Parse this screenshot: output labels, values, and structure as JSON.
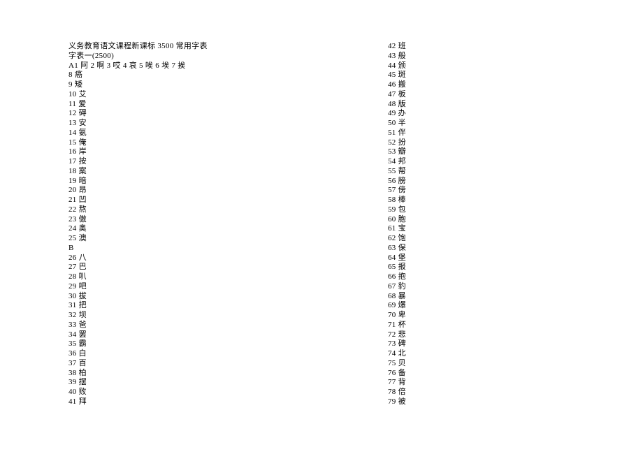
{
  "title": "义务教育语文课程新课标 3500 常用字表",
  "subtitle": "字表一(2500)",
  "line_a": "A1 阿 2 啊 3 哎 4 哀 5 唉 6 埃 7 挨",
  "section_b": "B",
  "left_entries": [
    "8 癌",
    "9 矮",
    "10 艾",
    "11 爱",
    "12 碍",
    "13 安",
    "14 氨",
    "15 俺",
    "16 岸",
    "17 按",
    "18 案",
    "19 暗",
    "20 昂",
    "21 凹",
    "22 熬",
    "23 傲",
    "24 奥",
    "25 澳"
  ],
  "left_entries_b": [
    "26 八",
    "27 巴",
    "28 叭",
    "29 吧",
    "30 拔",
    "31 把",
    "32 坝",
    "33 爸",
    "34 罢",
    "35 霸",
    "36 白",
    "37 百",
    "38 柏",
    "39 摆",
    "40 败",
    "41 拜"
  ],
  "right_entries": [
    "42 班",
    "43 般",
    "44 颁",
    "45 斑",
    "46 搬",
    "47 板",
    "48 版",
    "49 办",
    "50 半",
    "51 伴",
    "52 扮",
    "53 瓣",
    "54 邦",
    "55 帮",
    "56 膀",
    "57 傍",
    "58 棒",
    "59 包",
    "60 胞",
    "61 宝",
    "62 饱",
    "63 保",
    "64 堡",
    "65 报",
    "66 抱",
    "67 豹",
    "68 暴",
    "69 爆",
    "70 卑",
    "71 杯",
    "72 悲",
    "73 碑",
    "74 北",
    "75 贝",
    "76 备",
    "77 背",
    "78 倍",
    "79 被"
  ]
}
